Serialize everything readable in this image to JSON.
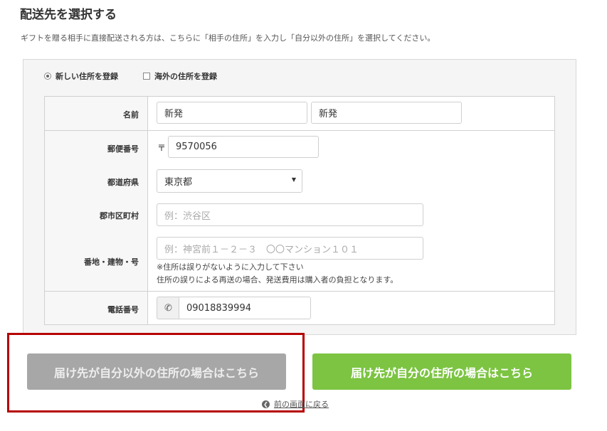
{
  "header": {
    "title": "配送先を選択する",
    "description": "ギフトを贈る相手に直接配送される方は、こちらに「相手の住所」を入力し「自分以外の住所」を選択してください。"
  },
  "options": {
    "new_address": "新しい住所を登録",
    "overseas_address": "海外の住所を登録"
  },
  "form": {
    "name_label": "名前",
    "name_last": "新発",
    "name_first": "新発",
    "postal_label": "郵便番号",
    "postal_prefix": "〒",
    "postal_value": "9570056",
    "prefecture_label": "都道府県",
    "prefecture_value": "東京都",
    "city_label": "郡市区町村",
    "city_placeholder": "例：渋谷区",
    "street_label": "番地・建物・号",
    "street_placeholder": "例：神宮前１－２－３　〇〇マンション１０１",
    "street_note1": "※住所は誤りがないように入力して下さい",
    "street_note2": "住所の誤りによる再送の場合、発送費用は購入者の負担となります。",
    "phone_label": "電話番号",
    "phone_value": "09018839994"
  },
  "buttons": {
    "other_address": "届け先が自分以外の住所の場合はこちら",
    "own_address": "届け先が自分の住所の場合はこちら",
    "back": "前の画面に戻る"
  },
  "icons": {
    "phone": "phone-icon",
    "back": "chevron-left-circle-icon"
  },
  "colors": {
    "primary_button": "#7cc442",
    "secondary_button": "#a7a7a7",
    "highlight_border": "#b60000"
  }
}
